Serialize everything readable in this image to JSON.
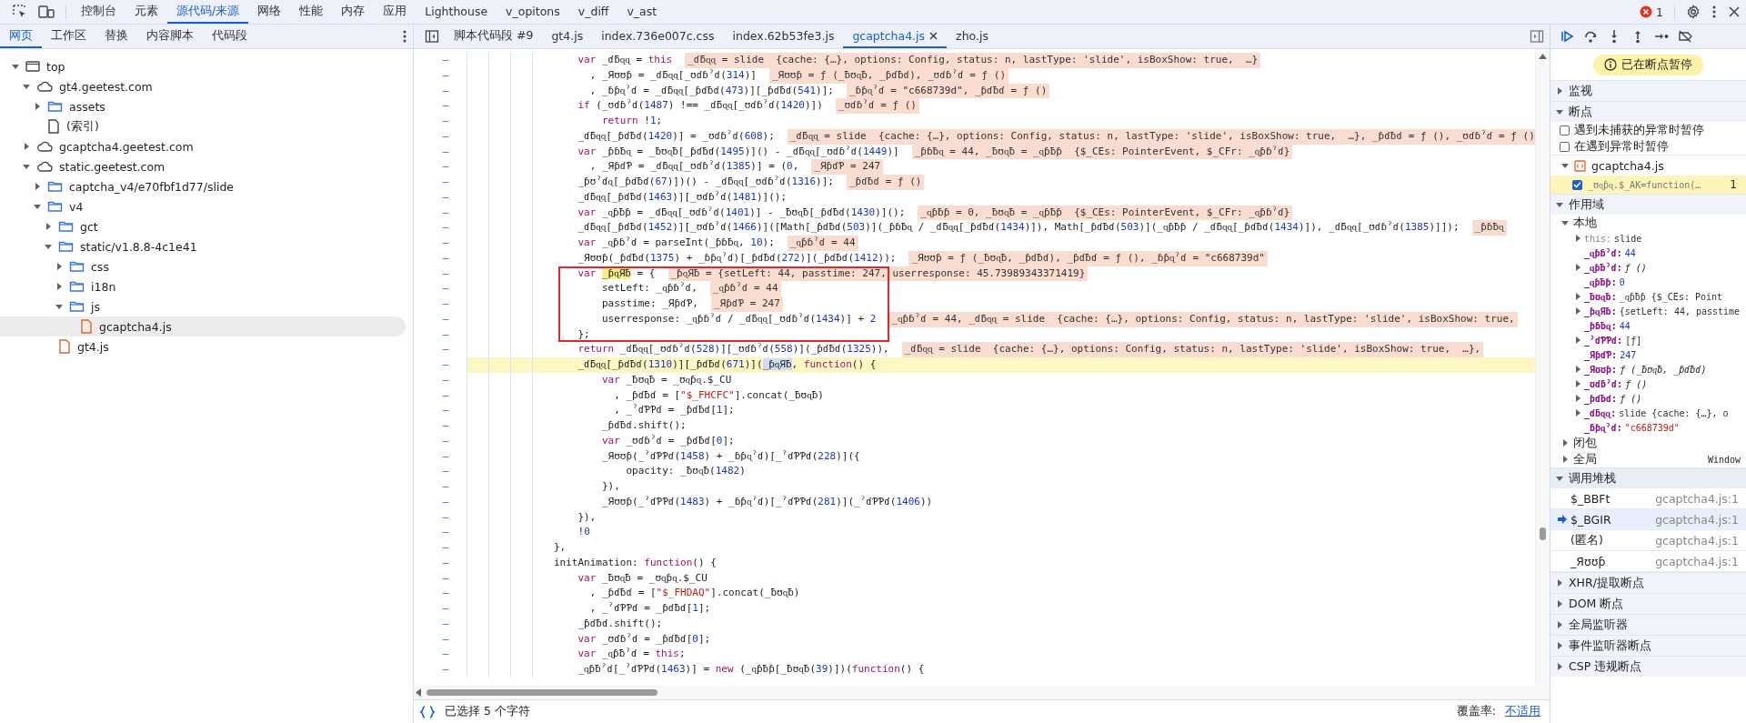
{
  "toolbar": {
    "tabs": [
      {
        "label": "控制台",
        "selected": false
      },
      {
        "label": "元素",
        "selected": false
      },
      {
        "label": "源代码/来源",
        "selected": true
      },
      {
        "label": "网络",
        "selected": false
      },
      {
        "label": "性能",
        "selected": false
      },
      {
        "label": "内存",
        "selected": false
      },
      {
        "label": "应用",
        "selected": false
      },
      {
        "label": "Lighthouse",
        "selected": false
      },
      {
        "label": "v_opitons",
        "selected": false
      },
      {
        "label": "v_diff",
        "selected": false
      },
      {
        "label": "v_ast",
        "selected": false
      }
    ],
    "error_count": "1"
  },
  "navigator": {
    "tabs": [
      {
        "label": "网页",
        "selected": true
      },
      {
        "label": "工作区",
        "selected": false
      },
      {
        "label": "替换",
        "selected": false
      },
      {
        "label": "内容脚本",
        "selected": false
      },
      {
        "label": "代码段",
        "selected": false
      }
    ],
    "tree": [
      {
        "label": "top",
        "kind": "frame",
        "expanded": true,
        "selected": false,
        "children": [
          {
            "label": "gt4.geetest.com",
            "kind": "domain",
            "expanded": true,
            "selected": false,
            "children": [
              {
                "label": "assets",
                "kind": "folder",
                "expanded": false,
                "selected": false
              },
              {
                "label": "(索引)",
                "kind": "document",
                "selected": false
              }
            ]
          },
          {
            "label": "gcaptcha4.geetest.com",
            "kind": "domain",
            "expanded": false,
            "selected": false
          },
          {
            "label": "static.geetest.com",
            "kind": "domain",
            "expanded": true,
            "selected": false,
            "children": [
              {
                "label": "captcha_v4/e70fbf1d77/slide",
                "kind": "folder",
                "expanded": false,
                "selected": false
              },
              {
                "label": "v4",
                "kind": "folder",
                "expanded": true,
                "selected": false,
                "children": [
                  {
                    "label": "gct",
                    "kind": "folder",
                    "expanded": false,
                    "selected": false
                  },
                  {
                    "label": "static/v1.8.8-4c1e41",
                    "kind": "folder",
                    "expanded": true,
                    "selected": false,
                    "children": [
                      {
                        "label": "css",
                        "kind": "folder",
                        "expanded": false,
                        "selected": false
                      },
                      {
                        "label": "i18n",
                        "kind": "folder",
                        "expanded": false,
                        "selected": false
                      },
                      {
                        "label": "js",
                        "kind": "folder",
                        "expanded": true,
                        "selected": false,
                        "children": [
                          {
                            "label": "gcaptcha4.js",
                            "kind": "script",
                            "selected": true
                          }
                        ]
                      }
                    ]
                  },
                  {
                    "label": "gt4.js",
                    "kind": "script",
                    "selected": false
                  }
                ]
              }
            ]
          }
        ]
      }
    ]
  },
  "editor": {
    "tabs": [
      {
        "label": "脚本代码段 #9",
        "selected": false,
        "closable": false
      },
      {
        "label": "gt4.js",
        "selected": false,
        "closable": false
      },
      {
        "label": "index.736e007c.css",
        "selected": false,
        "closable": false
      },
      {
        "label": "index.62b53fe3.js",
        "selected": false,
        "closable": false
      },
      {
        "label": "gcaptcha4.js",
        "selected": true,
        "closable": true
      },
      {
        "label": "zho.js",
        "selected": false,
        "closable": false
      }
    ],
    "lines": [
      {
        "gutter": "–",
        "current": false,
        "boxed": false,
        "code": [
          {
            "kind": "code",
            "text": "    var _ɗƃɋɋ = this"
          }
        ],
        "inline_value": "_ɗƃɋɋ = slide  {cache: {…}, options: Config, status: n, lastType: 'slide', isBoxShow: true,  …}"
      },
      {
        "gutter": "–",
        "current": false,
        "boxed": false,
        "code": [
          {
            "kind": "code",
            "text": "      , _Яʊʊƥ = _ɗƃɋɋ[_ʊɗɓˀɗ(314)]"
          }
        ],
        "inline_value": "_Яʊʊƥ = ƒ (_ƀʊɋƀ, _ƥɗƀɗ), _ʊɗɓˀɗ = ƒ ()"
      },
      {
        "gutter": "–",
        "current": false,
        "boxed": false,
        "code": [
          {
            "kind": "code",
            "text": "      , _ɓƥɋˀɗ = _ɗƃɋɋ[_ƥɗƀɗ(473)][_ƥɗƀɗ(541)];"
          }
        ],
        "inline_value": "_ɓƥɋˀɗ = \"c668739d\", _ƥɗƀɗ = ƒ ()"
      },
      {
        "gutter": "–",
        "current": false,
        "boxed": false,
        "code": [
          {
            "kind": "code",
            "text": "    if (_ʊɗɓˀɗ(1487) !== _ɗƃɋɋ[_ʊɗɓˀɗ(1420)])"
          }
        ],
        "inline_value": "_ʊɗɓˀɗ = ƒ ()"
      },
      {
        "gutter": "–",
        "current": false,
        "boxed": false,
        "code": [
          {
            "kind": "code",
            "text": "        return !1;"
          }
        ]
      },
      {
        "gutter": "–",
        "current": false,
        "boxed": false,
        "code": [
          {
            "kind": "code",
            "text": "    _ɗƃɋɋ[_ƥɗƀɗ(1420)] = _ʊɗɓˀɗ(608);"
          }
        ],
        "inline_value": "_ɗƃɋɋ = slide  {cache: {…}, options: Config, status: n, lastType: 'slide', isBoxShow: true,  …}, _ƥɗƀɗ = ƒ (), _ʊɗɓˀɗ = ƒ ()"
      },
      {
        "gutter": "–",
        "current": false,
        "boxed": false,
        "code": [
          {
            "kind": "code",
            "text": "    var _ƥɓƀɋ = _ƀʊɋƀ[_ƥɗƀɗ(1495)]() - _ɗƃɋɋ[_ʊɗɓˀɗ(1449)]"
          }
        ],
        "inline_value": "_ƥɓƀɋ = 44, _ƀʊɋƀ = _ɋƥƀƥ  {$_CEs: PointerEvent, $_CFr: _ɋƥɓˀɗ}"
      },
      {
        "gutter": "–",
        "current": false,
        "boxed": false,
        "code": [
          {
            "kind": "code",
            "text": "      , _ЯƥɗƤ = _ɗƃɋɋ[_ʊɗɓˀɗ(1385)] = (0,"
          }
        ],
        "inline_value": "_ЯƥɗƤ = 247"
      },
      {
        "gutter": "–",
        "current": false,
        "boxed": false,
        "code": [
          {
            "kind": "code",
            "text": "    _ƥʊˀɗɋ[_ƥɗƀɗ(67)])() - _ɗƃɋɋ[_ʊɗɓˀɗ(1316)];"
          }
        ],
        "inline_value": "_ƥɗƀɗ = ƒ ()"
      },
      {
        "gutter": "–",
        "current": false,
        "boxed": false,
        "code": [
          {
            "kind": "code",
            "text": "    _ɗƃɋɋ[_ƥɗƀɗ(1463)][_ʊɗɓˀɗ(1481)]();"
          }
        ]
      },
      {
        "gutter": "–",
        "current": false,
        "boxed": false,
        "code": [
          {
            "kind": "code",
            "text": "    var _ɋƥƀƥ = _ɗƃɋɋ[_ʊɗɓˀɗ(1401)] - _ƀʊɋƀ[_ƥɗƀɗ(1430)]();"
          }
        ],
        "inline_value": "_ɋƥƀƥ = 0, _ƀʊɋƀ = _ɋƥƀƥ  {$_CEs: PointerEvent, $_CFr: _ɋƥɓˀɗ}"
      },
      {
        "gutter": "–",
        "current": false,
        "boxed": false,
        "code": [
          {
            "kind": "code",
            "text": "    _ɗƃɋɋ[_ƥɗƀɗ(1452)][_ʊɗɓˀɗ(1466)]([Math[_ƥɗƀɗ(503)](_ƥɓƀɋ / _ɗƃɋɋ[_ƥɗƀɗ(1434)]), Math[_ƥɗƀɗ(503)](_ɋƥƀƥ / _ɗƃɋɋ[_ƥɗƀɗ(1434)]), _ɗƃɋɋ[_ʊɗɓˀɗ(1385)]]);"
          }
        ],
        "inline_value": "_ƥɓƀɋ"
      },
      {
        "gutter": "–",
        "current": false,
        "boxed": false,
        "code": [
          {
            "kind": "code",
            "text": "    var _ɋƥɓˀɗ = parseInt(_ƥɓƀɋ, 10);"
          }
        ],
        "inline_value": "_ɋƥɓˀɗ = 44"
      },
      {
        "gutter": "–",
        "current": false,
        "boxed": false,
        "code": [
          {
            "kind": "code",
            "text": "    _Яʊʊƥ(_ƥɗƀɗ(1375) + _ɓƥɋˀɗ)[_ƥɗƀɗ(272)](_ƥɗƀɗ(1412));"
          }
        ],
        "inline_value": "_Яʊʊƥ = ƒ (_ƀʊɋƀ, _ƥɗƀɗ), _ƥɗƀɗ = ƒ (), _ɓƥɋˀɗ = \"c668739d\""
      },
      {
        "gutter": "–",
        "current": false,
        "boxed": true,
        "code": [
          {
            "kind": "code",
            "text": "    var "
          },
          {
            "kind": "search",
            "text": "_ƥɋЯƀ"
          },
          {
            "kind": "code",
            "text": " = {"
          }
        ],
        "inline_value": "_ƥɋЯƀ = {setLeft: 44, passtime: 247, userresponse: 45.73989343371419}"
      },
      {
        "gutter": "–",
        "current": false,
        "boxed": true,
        "code": [
          {
            "kind": "code",
            "text": "        setLeft: _ɋƥɓˀɗ,"
          }
        ],
        "inline_value": "_ɋƥɓˀɗ = 44"
      },
      {
        "gutter": "–",
        "current": false,
        "boxed": true,
        "code": [
          {
            "kind": "code",
            "text": "        passtime: _ЯƥɗƤ,"
          }
        ],
        "inline_value": "_ЯƥɗƤ = 247"
      },
      {
        "gutter": "–",
        "current": false,
        "boxed": true,
        "code": [
          {
            "kind": "code",
            "text": "        userresponse: _ɋƥɓˀɗ / _ɗƃɋɋ[_ʊɗɓˀɗ(1434)] + 2"
          }
        ],
        "inline_value": "_ɋƥɓˀɗ = 44, _ɗƃɋɋ = slide  {cache: {…}, options: Config, status: n, lastType: 'slide', isBoxShow: true,"
      },
      {
        "gutter": "–",
        "current": false,
        "boxed": true,
        "code": [
          {
            "kind": "code",
            "text": "    };"
          }
        ]
      },
      {
        "gutter": "–",
        "current": false,
        "boxed": false,
        "code": [
          {
            "kind": "code",
            "text": "    return _ɗƃɋɋ[_ʊɗɓˀɗ(528)][_ʊɗɓˀɗ(558)](_ƥɗƀɗ(1325)),"
          }
        ],
        "inline_value": "_ɗƃɋɋ = slide  {cache: {…}, options: Config, status: n, lastType: 'slide', isBoxShow: true,  …},"
      },
      {
        "gutter": "–",
        "current": true,
        "boxed": false,
        "code": [
          {
            "kind": "code",
            "text": "    _ɗƃɋɋ[_ƥɗƀɗ(1310)][_ƥɗƀɗ(671)]("
          },
          {
            "kind": "selection",
            "text": "_ƥɋЯƀ"
          },
          {
            "kind": "code",
            "text": ", function() {"
          }
        ]
      },
      {
        "gutter": "–",
        "current": false,
        "boxed": false,
        "code": [
          {
            "kind": "code",
            "text": "        var _ƀʊɋƀ = _ʊɋƥɋ.$_CU"
          }
        ]
      },
      {
        "gutter": "–",
        "current": false,
        "boxed": false,
        "code": [
          {
            "kind": "code",
            "text": "          , _ƥɗƀɗ = [\"$_FHCFC\"].concat(_ƀʊɋƀ)"
          }
        ]
      },
      {
        "gutter": "–",
        "current": false,
        "boxed": false,
        "code": [
          {
            "kind": "code",
            "text": "          , _ˀɗƤƤɗ = _ƥɗƀɗ[1];"
          }
        ]
      },
      {
        "gutter": "–",
        "current": false,
        "boxed": false,
        "code": [
          {
            "kind": "code",
            "text": "        _ƥɗƀɗ.shift();"
          }
        ]
      },
      {
        "gutter": "–",
        "current": false,
        "boxed": false,
        "code": [
          {
            "kind": "code",
            "text": "        var _ʊɗɓˀɗ = _ƥɗƀɗ[0];"
          }
        ]
      },
      {
        "gutter": "–",
        "current": false,
        "boxed": false,
        "code": [
          {
            "kind": "code",
            "text": "        _Яʊʊƥ(_ˀɗƤƤɗ(1458) + _ɓƥɋˀɗ)[_ˀɗƤƤɗ(228)]({"
          }
        ]
      },
      {
        "gutter": "–",
        "current": false,
        "boxed": false,
        "code": [
          {
            "kind": "code",
            "text": "            opacity: _ƀʊɋƀ(1482)"
          }
        ]
      },
      {
        "gutter": "–",
        "current": false,
        "boxed": false,
        "code": [
          {
            "kind": "code",
            "text": "        }),"
          }
        ]
      },
      {
        "gutter": "–",
        "current": false,
        "boxed": false,
        "code": [
          {
            "kind": "code",
            "text": "        _Яʊʊƥ(_ˀɗƤƤɗ(1483) + _ɓƥɋˀɗ)[_ˀɗƤƤɗ(281)](_ˀɗƤƤɗ(1406))"
          }
        ]
      },
      {
        "gutter": "–",
        "current": false,
        "boxed": false,
        "code": [
          {
            "kind": "code",
            "text": "    }),"
          }
        ]
      },
      {
        "gutter": "–",
        "current": false,
        "boxed": false,
        "code": [
          {
            "kind": "code",
            "text": "    !0"
          }
        ]
      },
      {
        "gutter": "–",
        "current": false,
        "boxed": false,
        "code": [
          {
            "kind": "code",
            "text": "},"
          }
        ]
      },
      {
        "gutter": "–",
        "current": false,
        "boxed": false,
        "code": [
          {
            "kind": "code",
            "text": "initAnimation: function() {"
          }
        ]
      },
      {
        "gutter": "–",
        "current": false,
        "boxed": false,
        "code": [
          {
            "kind": "code",
            "text": "    var _ƀʊɋƀ = _ʊɋƥɋ.$_CU"
          }
        ]
      },
      {
        "gutter": "–",
        "current": false,
        "boxed": false,
        "code": [
          {
            "kind": "code",
            "text": "      , _ƥɗƀɗ = [\"$_FHDAQ\"].concat(_ƀʊɋƀ)"
          }
        ]
      },
      {
        "gutter": "–",
        "current": false,
        "boxed": false,
        "code": [
          {
            "kind": "code",
            "text": "      , _ˀɗƤƤɗ = _ƥɗƀɗ[1];"
          }
        ]
      },
      {
        "gutter": "–",
        "current": false,
        "boxed": false,
        "code": [
          {
            "kind": "code",
            "text": "    _ƥɗƀɗ.shift();"
          }
        ]
      },
      {
        "gutter": "–",
        "current": false,
        "boxed": false,
        "code": [
          {
            "kind": "code",
            "text": "    var _ʊɗɓˀɗ = _ƥɗƀɗ[0];"
          }
        ]
      },
      {
        "gutter": "–",
        "current": false,
        "boxed": false,
        "code": [
          {
            "kind": "code",
            "text": "    var _ɋƥƀˀɗ = this;"
          }
        ]
      },
      {
        "gutter": "–",
        "current": false,
        "boxed": false,
        "code": [
          {
            "kind": "code",
            "text": "    _ɋƥƀˀɗ[_ˀɗƤƤɗ(1463)] = new (_ɋƥƀƥ[_ƀʊɋƀ(39)])(function() {"
          }
        ]
      }
    ],
    "status": {
      "selection": "已选择 5 个字符",
      "coverage_label": "覆盖率:",
      "coverage_value": "不适用"
    }
  },
  "debugger": {
    "paused_message": "已在断点暂停",
    "panes": [
      {
        "kind": "watch",
        "title": "监视",
        "expanded": false
      },
      {
        "kind": "breakpoints",
        "title": "断点",
        "expanded": true,
        "options": [
          {
            "label": "遇到未捕获的异常时暂停",
            "checked": false
          },
          {
            "label": "在遇到异常时暂停",
            "checked": false
          }
        ],
        "files": [
          {
            "name": "gcaptcha4.js",
            "expanded": true,
            "breakpoints": [
              {
                "code": "_ʊɋƥɋ.$_AK=function(…",
                "line": "1",
                "checked": true,
                "hit": true
              }
            ]
          }
        ]
      },
      {
        "kind": "scope",
        "title": "作用域",
        "expanded": true,
        "scopes": [
          {
            "label": "本地",
            "expanded": true,
            "variables": [
              {
                "name": "this:",
                "value": "slide",
                "kind": "object",
                "receiver": true,
                "expanded": false
              },
              {
                "name": "_ɋƥɓˀɗ:",
                "value": "44",
                "kind": "number",
                "receiver": false
              },
              {
                "name": "_ɋƥƀˀɗ:",
                "value": "ƒ ()",
                "kind": "function",
                "receiver": false,
                "expanded": false
              },
              {
                "name": "_ɋƥƀƥ:",
                "value": "0",
                "kind": "number",
                "receiver": false
              },
              {
                "name": "_ƀʊɋƀ:",
                "value": "_ɋƥƀƥ  {$_CEs: Point",
                "kind": "object",
                "receiver": false,
                "expanded": false
              },
              {
                "name": "_ƥɋЯƀ:",
                "value": "{setLeft: 44, passtime",
                "kind": "object",
                "receiver": false,
                "expanded": false
              },
              {
                "name": "_ƥɓƀɋ:",
                "value": "44",
                "kind": "number",
                "receiver": false
              },
              {
                "name": "_ˀɗƤƤɗ:",
                "value": "[ƒ]",
                "kind": "object",
                "receiver": false,
                "expanded": false
              },
              {
                "name": "_ЯƥɗƤ:",
                "value": "247",
                "kind": "number",
                "receiver": false
              },
              {
                "name": "_Яʊʊƥ:",
                "value": "ƒ (_ƀʊɋƀ, _ƥɗƀɗ)",
                "kind": "function",
                "receiver": false,
                "expanded": false
              },
              {
                "name": "_ʊɗɓˀɗ:",
                "value": "ƒ ()",
                "kind": "function",
                "receiver": false,
                "expanded": false
              },
              {
                "name": "_ƥɗƀɗ:",
                "value": "ƒ ()",
                "kind": "function",
                "receiver": false,
                "expanded": false
              },
              {
                "name": "_ɗƃɋɋ:",
                "value": "slide  {cache: {…}, o",
                "kind": "object",
                "receiver": false,
                "expanded": false
              },
              {
                "name": "_ɓƥɋˀɗ:",
                "value": "\"c668739d\"",
                "kind": "string",
                "receiver": false
              }
            ]
          },
          {
            "label": "闭包",
            "expanded": false
          },
          {
            "label": "全局",
            "expanded": false,
            "value": "Window"
          }
        ]
      },
      {
        "kind": "call_stack",
        "title": "调用堆栈",
        "expanded": true,
        "frames": [
          {
            "name": "$_BBFt",
            "location": "gcaptcha4.js:1",
            "selected": false
          },
          {
            "name": "$_BGIR",
            "location": "gcaptcha4.js:1",
            "selected": true
          },
          {
            "name": "(匿名)",
            "location": "gcaptcha4.js:1",
            "selected": false
          },
          {
            "name": "_Яʊʊƥ",
            "location": "gcaptcha4.js:1",
            "selected": false
          }
        ]
      },
      {
        "kind": "section",
        "title": "XHR/提取断点",
        "expanded": false
      },
      {
        "kind": "section",
        "title": "DOM 断点",
        "expanded": false
      },
      {
        "kind": "section",
        "title": "全局监听器",
        "expanded": false
      },
      {
        "kind": "section",
        "title": "事件监听器断点",
        "expanded": false
      },
      {
        "kind": "section",
        "title": "CSP 违规断点",
        "expanded": false
      }
    ]
  }
}
